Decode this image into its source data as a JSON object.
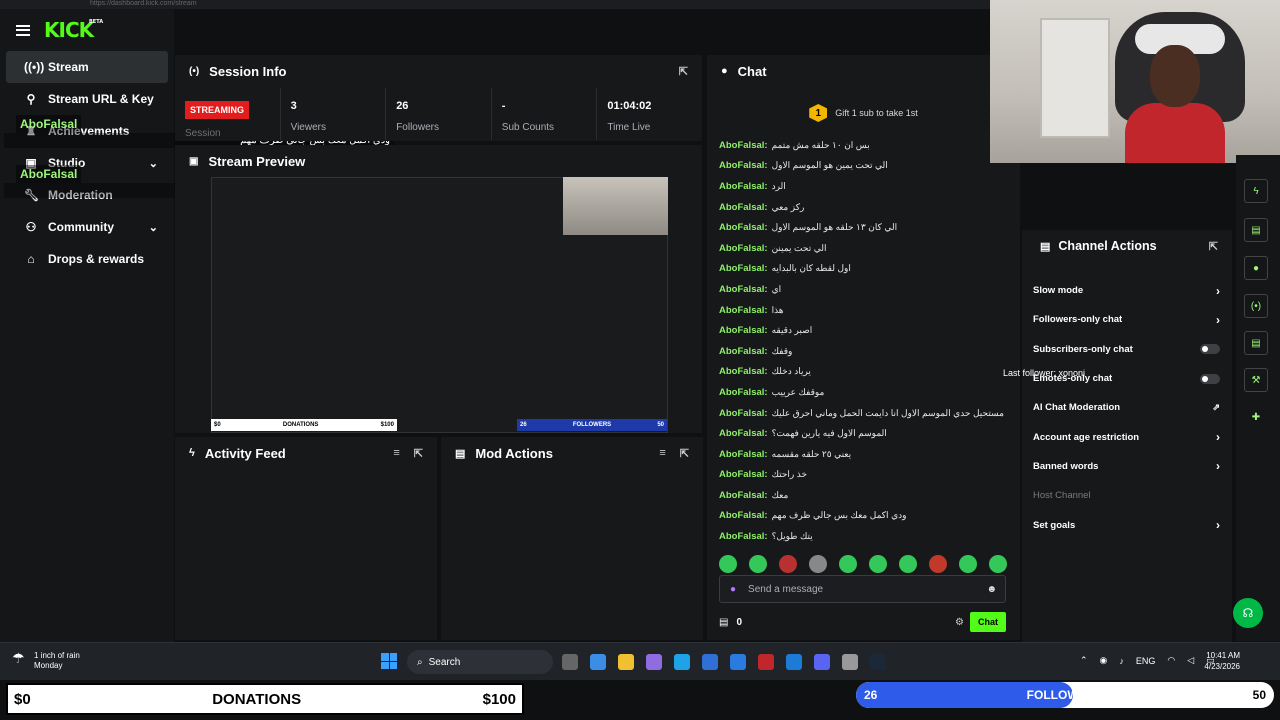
{
  "browser": {
    "url": "https://dashboard.kick.com/stream"
  },
  "brand": {
    "logo": "KICK",
    "beta": "BETA",
    "accent": "#53fc18"
  },
  "sidebar": {
    "items": [
      {
        "label": "Stream",
        "icon": "broadcast-icon",
        "active": true
      },
      {
        "label": "Stream URL & Key",
        "icon": "key-icon"
      },
      {
        "label": "Achievements",
        "icon": "trophy-icon"
      },
      {
        "label": "Studio",
        "icon": "studio-icon"
      },
      {
        "label": "Moderation",
        "icon": "wrench-icon"
      },
      {
        "label": "Community",
        "icon": "community-icon"
      },
      {
        "label": "Drops & rewards",
        "icon": "gift-icon"
      }
    ]
  },
  "overlay_chat": [
    {
      "user": "AboFalsal",
      "text": "ودي اكمل معك بس جالي ظرف مهم"
    },
    {
      "user": "AboFalsal",
      "text": "يتك طويل؟"
    }
  ],
  "session": {
    "title": "Session Info",
    "status": "STREAMING",
    "status_sub": "Session",
    "stats": [
      {
        "value": "3",
        "label": "Viewers"
      },
      {
        "value": "26",
        "label": "Followers"
      },
      {
        "value": "-",
        "label": "Sub Counts"
      },
      {
        "value": "01:04:02",
        "label": "Time Live"
      }
    ]
  },
  "preview": {
    "title": "Stream Preview",
    "mini_donations": "DONATIONS",
    "mini_d_left": "$0",
    "mini_d_right": "$100",
    "mini_followers": "FOLLOWERS",
    "mini_f_left": "26",
    "mini_f_right": "50"
  },
  "activity": {
    "title": "Activity Feed"
  },
  "mod_actions": {
    "title": "Mod Actions"
  },
  "chat": {
    "title": "Chat",
    "gift_count": "1",
    "gift_text": "Gift 1 sub to take 1st",
    "messages": [
      {
        "user": "AboFalsal:",
        "text": "بس ان ١٠ حلقه مش متمم"
      },
      {
        "user": "AboFalsal:",
        "text": "الي تحت يمين هو الموسم الاول"
      },
      {
        "user": "AboFalsal:",
        "text": "الرد"
      },
      {
        "user": "AboFalsal:",
        "text": "ركز معي"
      },
      {
        "user": "AboFalsal:",
        "text": "الي كان ١٣ حلقه هو الموسم الاول"
      },
      {
        "user": "AboFalsal:",
        "text": "الي تحت يمينن"
      },
      {
        "user": "AboFalsal:",
        "text": "اول لقطه كان بالبدايه"
      },
      {
        "user": "AboFalsal:",
        "text": "اي"
      },
      {
        "user": "AboFalsal:",
        "text": "هذا"
      },
      {
        "user": "AboFalsal:",
        "text": "اصبر دقيقه"
      },
      {
        "user": "AboFalsal:",
        "text": "وقفك"
      },
      {
        "user": "AboFalsal:",
        "text": "يرياد دخلك"
      },
      {
        "user": "AboFalsal:",
        "text": "موقفك عرييب"
      },
      {
        "user": "AboFalsal:",
        "text": "مستحيل حدي الموسم الاول انا دايمت الحمل وماني احرق عليك"
      },
      {
        "user": "AboFalsal:",
        "text": "الموسم الاول فيه يارين فهمت؟"
      },
      {
        "user": "AboFalsal:",
        "text": "يعني ٢٥ حلقه مقسمه"
      },
      {
        "user": "AboFalsal:",
        "text": "خذ راحتك"
      },
      {
        "user": "AboFalsal:",
        "text": "معك"
      },
      {
        "user": "AboFalsal:",
        "text": "ودي اكمل معك بس جالي ظرف مهم"
      },
      {
        "user": "AboFalsal:",
        "text": "يتك طويل؟"
      }
    ],
    "input_placeholder": "Send a message",
    "points": "0",
    "send_label": "Chat"
  },
  "channel_actions": {
    "title": "Channel Actions",
    "items": [
      {
        "label": "Slow mode",
        "control": "chevron"
      },
      {
        "label": "Followers-only chat",
        "control": "chevron"
      },
      {
        "label": "Subscribers-only chat",
        "control": "toggle"
      },
      {
        "label": "Emotes-only chat",
        "control": "toggle"
      },
      {
        "label": "AI Chat Moderation",
        "control": "external"
      },
      {
        "label": "Account age restriction",
        "control": "chevron"
      },
      {
        "label": "Banned words",
        "control": "chevron"
      },
      {
        "label": "Host Channel",
        "control": "none",
        "disabled": true
      },
      {
        "label": "Set goals",
        "control": "chevron"
      }
    ]
  },
  "last_follower": "Last follower: xononi",
  "taskbar": {
    "weather_title": "1 inch of rain",
    "weather_sub": "Monday",
    "search": "Search",
    "lang": "ENG",
    "time": "10:41 AM",
    "date": "4/23/2026"
  },
  "goals": {
    "donations": {
      "left": "$0",
      "label": "DONATIONS",
      "right": "$100",
      "progress": 0
    },
    "followers": {
      "left": "26",
      "label": "FOLLOWERS",
      "right": "50",
      "progress": 0.52
    }
  }
}
